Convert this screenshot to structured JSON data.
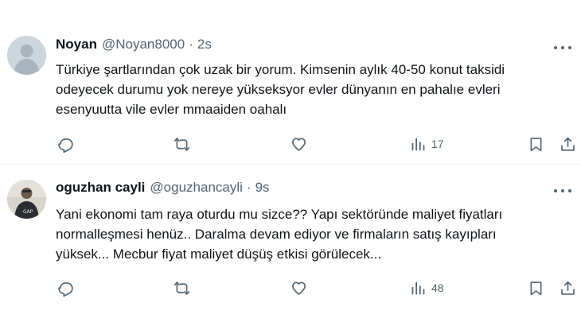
{
  "tweets": [
    {
      "name": "Noyan",
      "handle": "@Noyan8000",
      "separator": "·",
      "time": "2s",
      "lines": [
        "Türkiye şartlarından çok uzak bir yorum. Kimsenin aylık 40-50 konut taksidi",
        "odeyecek durumu yok nereye yükseksyor evler dünyanın en pahalıe evleri",
        "esenyuutta vile evler mmaaiden oahalı"
      ],
      "views": "17"
    },
    {
      "name": "oguzhan cayli",
      "handle": "@oguzhancayli",
      "separator": "·",
      "time": "9s",
      "lines": [
        "Yani ekonomi tam raya oturdu mu sizce?? Yapı sektöründe maliyet fiyatları",
        "normalleşmesi henüz.. Daralma devam ediyor ve firmaların satış kayıpları",
        "yüksek... Mecbur fiyat maliyet düşüş etkisi görülecek..."
      ],
      "views": "48"
    }
  ],
  "colors": {
    "text_primary": "#0f1419",
    "text_secondary": "#536471",
    "divider": "#eff3f4",
    "default_avatar": "#ccd6dd"
  },
  "icons": [
    "reply-icon",
    "retweet-icon",
    "like-icon",
    "views-icon",
    "bookmark-icon",
    "share-icon",
    "more-icon"
  ]
}
